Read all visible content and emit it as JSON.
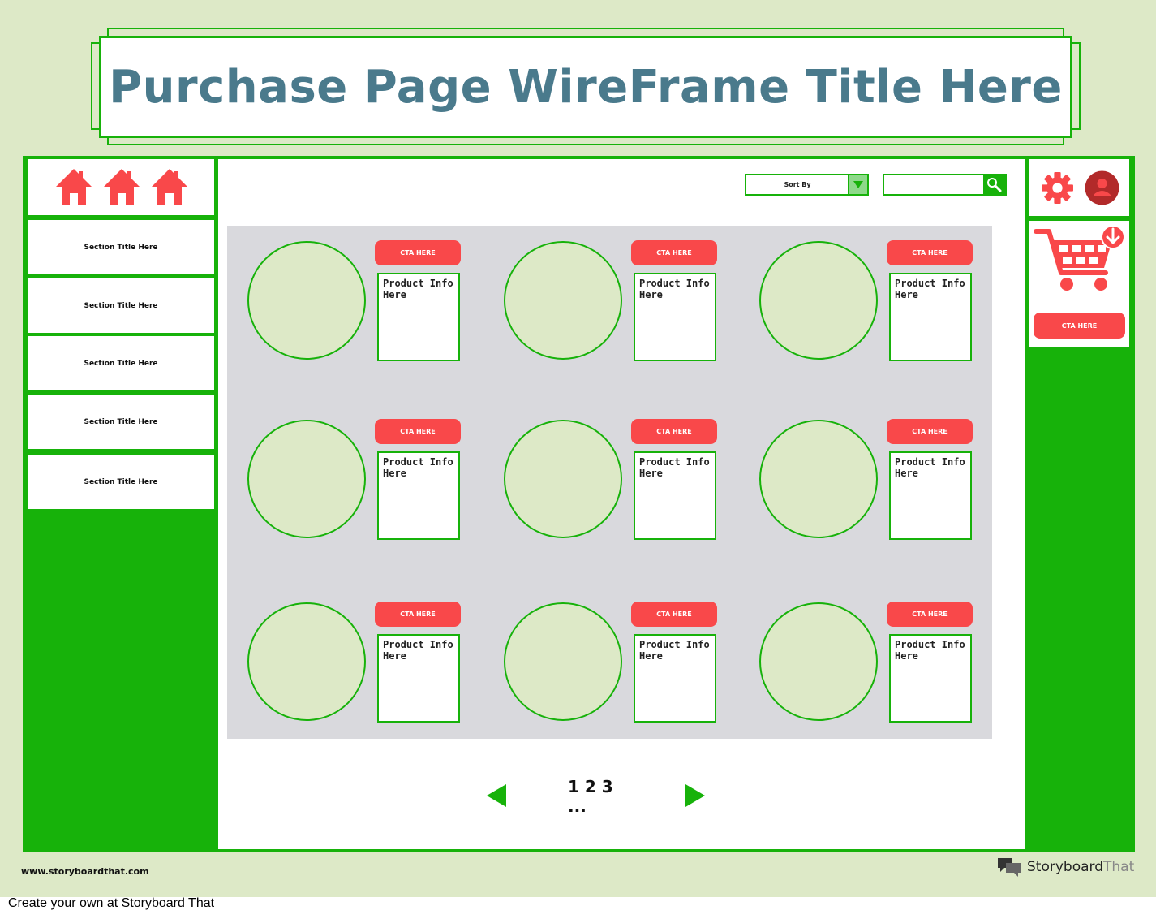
{
  "title": "Purchase Page WireFrame Title Here",
  "sidebar": {
    "sections": [
      "Section Title Here",
      "Section Title Here",
      "Section Title Here",
      "Section Title Here",
      "Section Title Here"
    ]
  },
  "toolbar": {
    "sort_label": "Sort By",
    "search_placeholder": ""
  },
  "products": [
    {
      "cta": "CTA HERE",
      "info": "Product Info Here"
    },
    {
      "cta": "CTA HERE",
      "info": "Product Info Here"
    },
    {
      "cta": "CTA HERE",
      "info": "Product Info Here"
    },
    {
      "cta": "CTA HERE",
      "info": "Product Info Here"
    },
    {
      "cta": "CTA HERE",
      "info": "Product Info Here"
    },
    {
      "cta": "CTA HERE",
      "info": "Product Info Here"
    },
    {
      "cta": "CTA HERE",
      "info": "Product Info Here"
    },
    {
      "cta": "CTA HERE",
      "info": "Product Info Here"
    },
    {
      "cta": "CTA HERE",
      "info": "Product Info Here"
    }
  ],
  "pagination": {
    "pages": "1 2 3 ..."
  },
  "cart": {
    "cta": "CTA HERE"
  },
  "footer": {
    "url": "www.storyboardthat.com",
    "brand_main": "Storyboard",
    "brand_light": "That",
    "bottom_text": "Create your own at Storyboard That"
  },
  "colors": {
    "accent": "#f9484a",
    "frame": "#17b20a",
    "title": "#4a7a8c",
    "background": "#dde9c7"
  },
  "icons": [
    "home-icon",
    "gear-icon",
    "user-icon",
    "cart-icon",
    "search-icon",
    "dropdown-arrow-icon",
    "prev-arrow-icon",
    "next-arrow-icon"
  ]
}
